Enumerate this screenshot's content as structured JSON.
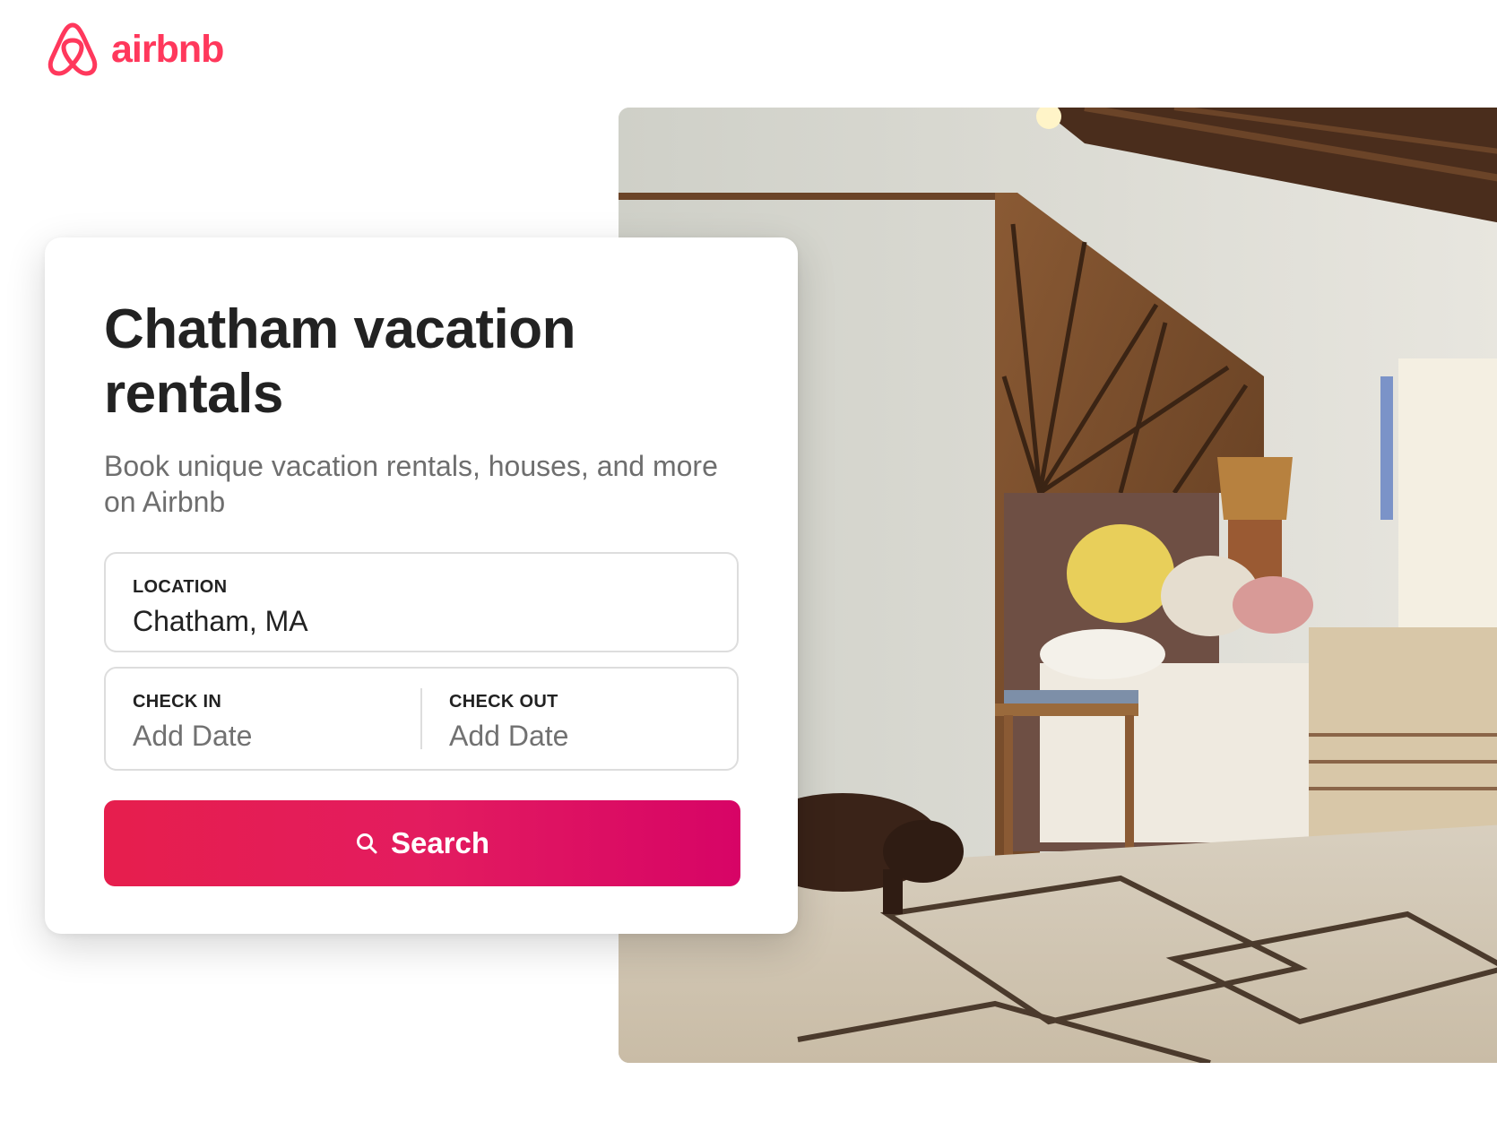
{
  "brand": {
    "name": "airbnb",
    "color": "#ff385c",
    "logo_icon": "airbnb-belo-icon"
  },
  "card": {
    "title": "Chatham vacation rentals",
    "subtitle": "Book unique vacation rentals, houses, and more on Airbnb"
  },
  "location": {
    "label": "LOCATION",
    "value": "Chatham, MA"
  },
  "check_in": {
    "label": "CHECK IN",
    "placeholder": "Add Date"
  },
  "check_out": {
    "label": "CHECK OUT",
    "placeholder": "Add Date"
  },
  "search": {
    "label": "Search",
    "icon": "search-icon",
    "gradient": [
      "#e61e4d",
      "#d70466"
    ]
  },
  "hero_photo": {
    "subject": "bedroom interior",
    "icon": "hero-photo"
  }
}
